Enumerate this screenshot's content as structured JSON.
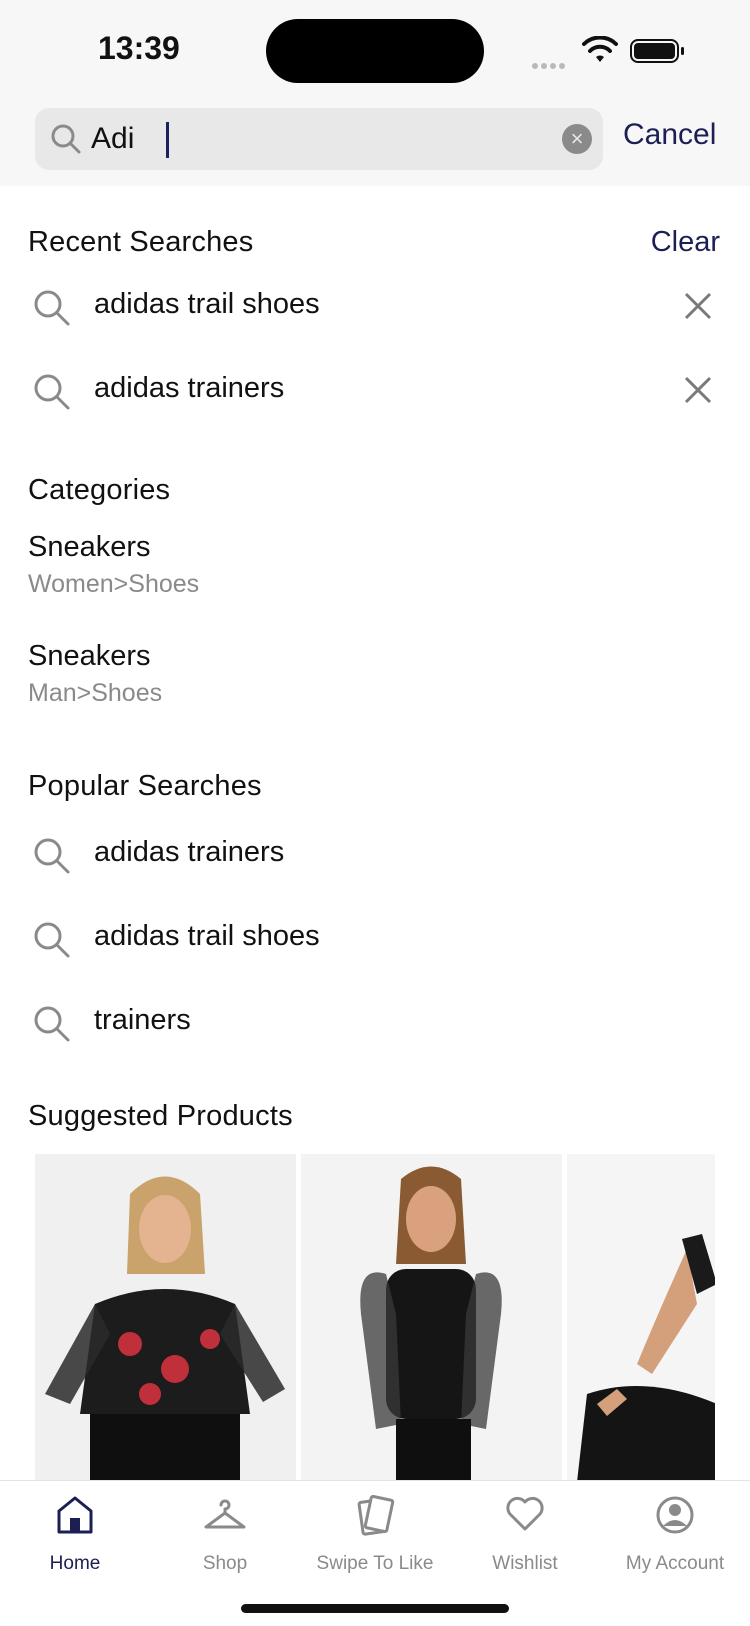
{
  "status_bar": {
    "time": "13:39"
  },
  "search": {
    "query": "Adi",
    "cancel_label": "Cancel"
  },
  "recent": {
    "title": "Recent Searches",
    "clear_label": "Clear",
    "items": [
      {
        "label": "adidas trail shoes"
      },
      {
        "label": "adidas trainers"
      }
    ]
  },
  "categories": {
    "title": "Categories",
    "items": [
      {
        "name": "Sneakers",
        "path": "Women>Shoes"
      },
      {
        "name": "Sneakers",
        "path": "Man>Shoes"
      }
    ]
  },
  "popular": {
    "title": "Popular Searches",
    "items": [
      {
        "label": "adidas trainers"
      },
      {
        "label": "adidas trail shoes"
      },
      {
        "label": "trainers"
      }
    ]
  },
  "suggested": {
    "title": "Suggested Products",
    "products": [
      {
        "image": "model-floral-mesh-top"
      },
      {
        "image": "model-black-dot-mesh-top"
      },
      {
        "image": "model-black-sleeve-seated"
      }
    ]
  },
  "tabbar": {
    "items": [
      {
        "label": "Home",
        "icon": "home-icon",
        "active": true
      },
      {
        "label": "Shop",
        "icon": "hanger-icon",
        "active": false
      },
      {
        "label": "Swipe To Like",
        "icon": "cards-icon",
        "active": false
      },
      {
        "label": "Wishlist",
        "icon": "heart-icon",
        "active": false
      },
      {
        "label": "My Account",
        "icon": "account-icon",
        "active": false
      }
    ]
  },
  "colors": {
    "accent": "#1b1f54",
    "muted": "#8a8a8a",
    "search_bg": "#e8e8e8"
  }
}
